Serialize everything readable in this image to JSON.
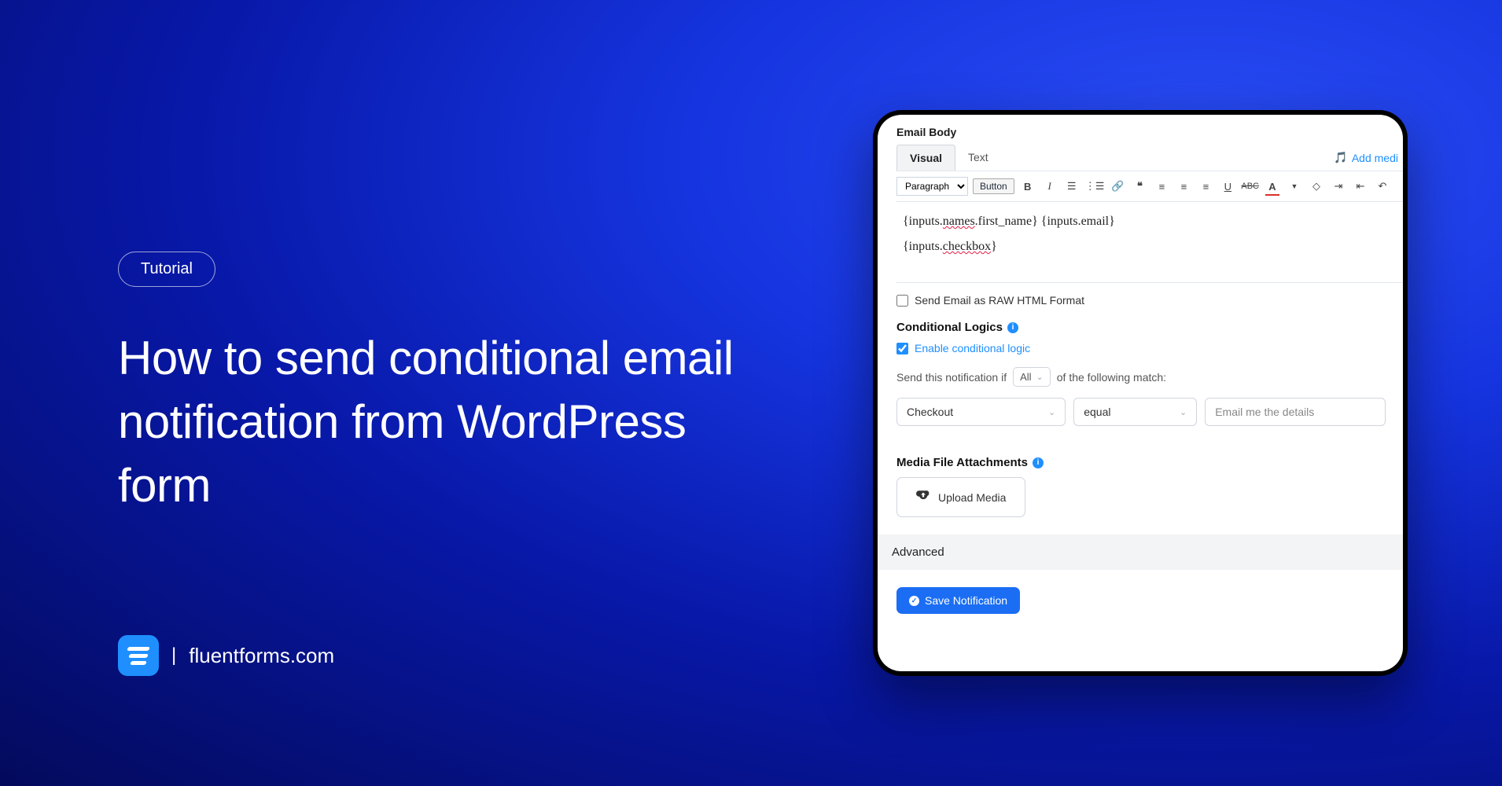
{
  "badge": "Tutorial",
  "headline": "How to send conditional email notification from WordPress form",
  "brand": "fluentforms.com",
  "panel": {
    "emailBodyLabel": "Email Body",
    "tabs": {
      "visual": "Visual",
      "text": "Text"
    },
    "addMedia": "Add medi",
    "formatSelect": "Paragraph",
    "buttonLabel": "Button",
    "bodyLine1a": "{inputs.",
    "bodyLine1b": "names",
    "bodyLine1c": ".first_name} {inputs.email}",
    "bodyLine2a": "{inputs.",
    "bodyLine2b": "checkbox",
    "bodyLine2c": "}",
    "rawHtmlLabel": "Send Email as RAW HTML Format",
    "conditional": {
      "heading": "Conditional Logics",
      "enable": "Enable conditional logic",
      "sent1": "Send this notification if",
      "match": "All",
      "sent2": "of the following match:",
      "field": "Checkout",
      "op": "equal",
      "value": "Email me the details"
    },
    "media": {
      "heading": "Media File Attachments",
      "upload": "Upload Media"
    },
    "advanced": "Advanced",
    "save": "Save Notification"
  }
}
